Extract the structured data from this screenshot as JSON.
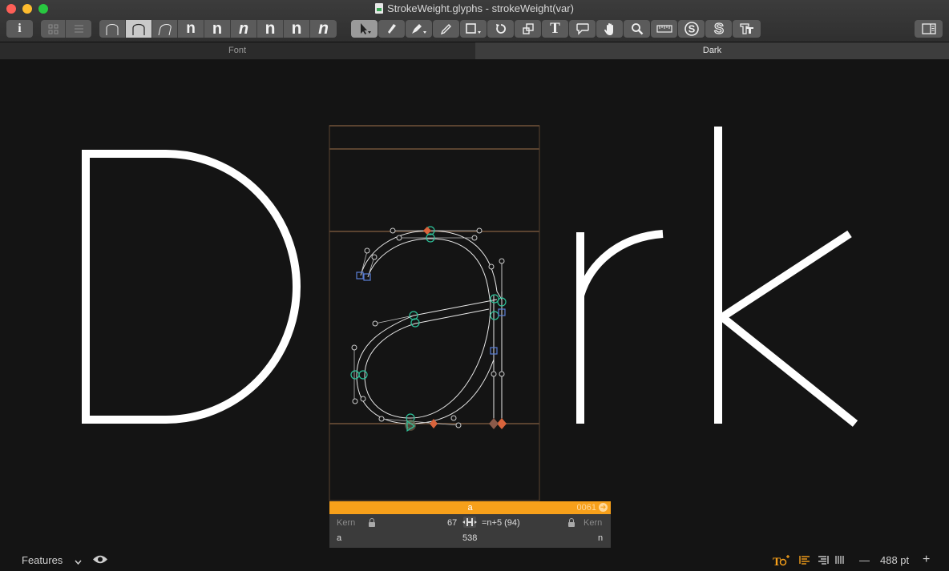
{
  "window": {
    "title": "StrokeWeight.glyphs - strokeWeight(var)"
  },
  "toolbar": {
    "info": "i",
    "weights": [
      "n",
      "n",
      "n",
      "n",
      "n",
      "n"
    ],
    "text_tool": "T",
    "panel_toggle": "sidebar-icon"
  },
  "tabs": [
    {
      "label": "Font",
      "active": false
    },
    {
      "label": "Dark",
      "active": true
    }
  ],
  "canvas": {
    "text": "Dark"
  },
  "glyph_info": {
    "name": "a",
    "unicode": "0061",
    "left_kern": "Kern",
    "right_kern": "Kern",
    "lsb": "67",
    "rsb": "=n+5 (94)",
    "left_glyph": "a",
    "width": "538",
    "right_glyph": "n"
  },
  "statusbar": {
    "features": "Features",
    "zoom": "488 pt",
    "minus": "—",
    "plus": "+"
  },
  "colors": {
    "accent": "#f7a01a",
    "node_smooth": "#2ec29a",
    "node_corner": "#e0623e",
    "handle_blue": "#5b7fd6"
  }
}
